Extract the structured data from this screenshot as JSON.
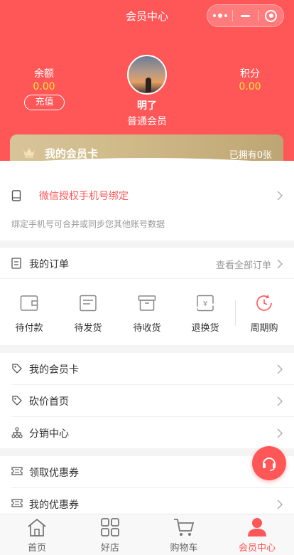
{
  "header": {
    "title": "会员中心",
    "capsule_icons": [
      "more-dots-icon",
      "minimize-icon",
      "close-target-icon"
    ],
    "accent_color": "#ff5658"
  },
  "profile": {
    "balance_label": "余额",
    "balance_value": "0.00",
    "recharge_label": "充值",
    "points_label": "积分",
    "points_value": "0.00",
    "username": "明了",
    "level": "普通会员"
  },
  "vip_card": {
    "title": "我的会员卡",
    "owned_text": "已拥有0张"
  },
  "bind_phone": {
    "label": "微信授权手机号绑定",
    "hint": "绑定手机号可合并或同步您其他账号数据"
  },
  "orders": {
    "title": "我的订单",
    "view_all": "查看全部订单",
    "items": [
      {
        "label": "待付款",
        "icon": "wallet-icon"
      },
      {
        "label": "待发货",
        "icon": "package-icon"
      },
      {
        "label": "待收货",
        "icon": "box-icon"
      },
      {
        "label": "退换货",
        "icon": "refund-icon"
      },
      {
        "label": "周期购",
        "icon": "clock-icon"
      }
    ]
  },
  "menu": [
    {
      "label": "我的会员卡",
      "icon": "tag-icon"
    },
    {
      "label": "砍价首页",
      "icon": "tag-icon"
    },
    {
      "label": "分销中心",
      "icon": "distribution-icon"
    },
    {
      "label": "领取优惠券",
      "icon": "coupon-icon"
    },
    {
      "label": "我的优惠券",
      "icon": "coupon-icon"
    }
  ],
  "tabbar": [
    {
      "label": "首页",
      "icon": "home-icon",
      "active": false
    },
    {
      "label": "好店",
      "icon": "grid-icon",
      "active": false
    },
    {
      "label": "购物车",
      "icon": "cart-icon",
      "active": false
    },
    {
      "label": "会员中心",
      "icon": "user-icon",
      "active": true
    }
  ],
  "customer_service_icon": "headset-icon"
}
